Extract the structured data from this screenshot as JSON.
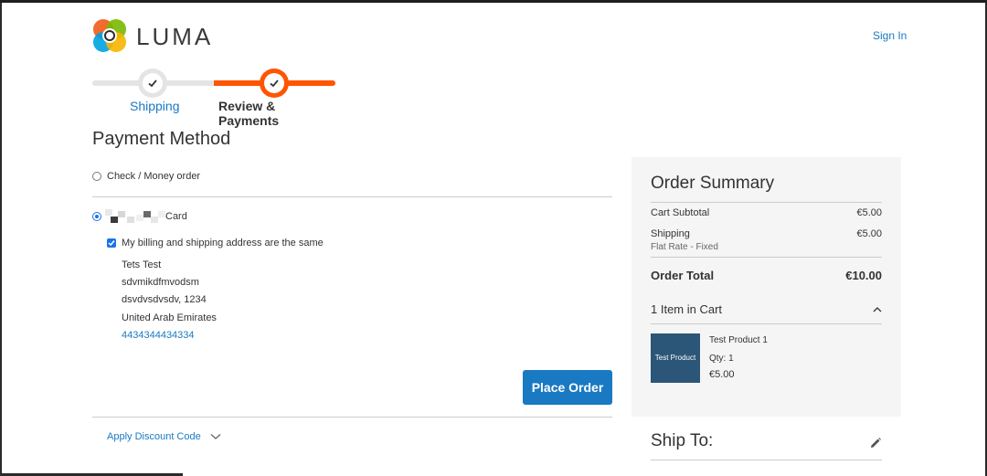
{
  "header": {
    "logo_text": "LUMA",
    "sign_in": "Sign In"
  },
  "progress": {
    "steps": [
      {
        "label": "Shipping",
        "state": "completed"
      },
      {
        "label": "Review & Payments",
        "state": "active"
      }
    ]
  },
  "payment": {
    "title": "Payment Method",
    "options": [
      {
        "label": "Check / Money order",
        "selected": false
      },
      {
        "label": "Card",
        "selected": true
      }
    ],
    "billing_same_label": "My billing and shipping address are the same",
    "billing_same_checked": true,
    "address": {
      "name": "Tets Test",
      "street": "sdvmikdfmvodsm",
      "city_zip": "dsvdvsdvsdv, 1234",
      "country": "United Arab Emirates",
      "phone": "4434344434334"
    },
    "place_order": "Place Order",
    "discount_label": "Apply Discount Code"
  },
  "summary": {
    "title": "Order Summary",
    "cart_subtotal_label": "Cart Subtotal",
    "cart_subtotal_value": "€5.00",
    "shipping_label": "Shipping",
    "shipping_value": "€5.00",
    "shipping_method": "Flat Rate - Fixed",
    "order_total_label": "Order Total",
    "order_total_value": "€10.00",
    "items_in_cart": "1 Item in Cart",
    "item": {
      "thumb_text": "Test Product",
      "name": "Test Product 1",
      "qty": "Qty: 1",
      "price": "€5.00"
    }
  },
  "ship_to": {
    "title": "Ship To:"
  },
  "colors": {
    "accent_orange": "#ff5501",
    "link_blue": "#1979c3",
    "button_blue": "#1979c3",
    "summary_bg": "#f5f5f5"
  }
}
